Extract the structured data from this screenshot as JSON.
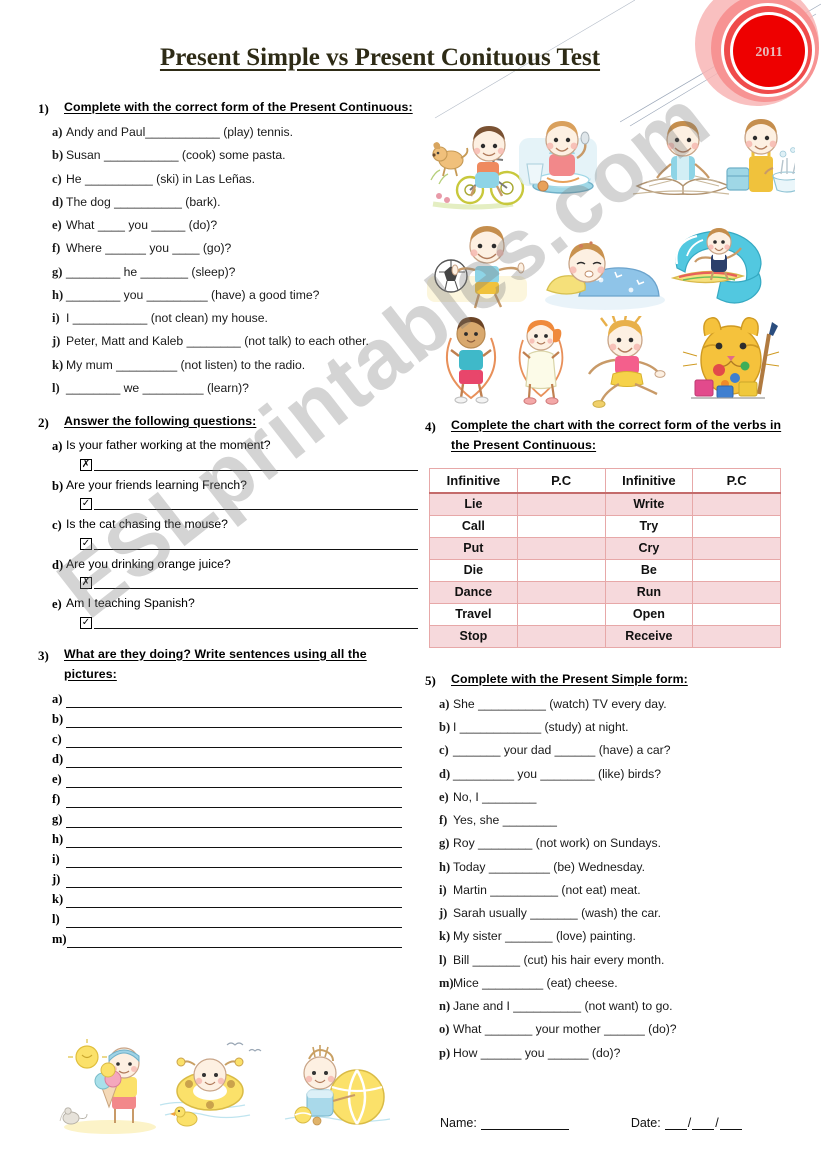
{
  "page": {
    "title": "Present Simple vs Present Conituous Test",
    "watermark": "ESLprintables.com",
    "badge_year": "2011",
    "accent_pink": "#f6d9dc",
    "accent_pink_border": "#e7a8a8",
    "badge_red": "#ee0000",
    "title_color": "#2e2b16"
  },
  "exercise1": {
    "number": "1)",
    "title": "Complete with the correct form of the Present Continuous:",
    "items": [
      {
        "letter": "a)",
        "text": "Andy and Paul___________ (play) tennis."
      },
      {
        "letter": "b)",
        "text": "Susan ___________ (cook) some pasta."
      },
      {
        "letter": "c)",
        "text": "He __________ (ski) in Las Leñas."
      },
      {
        "letter": "d)",
        "text": "The dog __________ (bark)."
      },
      {
        "letter": "e)",
        "text": "What ____ you _____ (do)?"
      },
      {
        "letter": "f)",
        "text": "Where ______ you ____ (go)?"
      },
      {
        "letter": "g)",
        "text": "________ he _______ (sleep)?"
      },
      {
        "letter": "h)",
        "text": "________ you _________ (have) a good time?"
      },
      {
        "letter": "i)",
        "text": "I ___________ (not clean) my house."
      },
      {
        "letter": "j)",
        "text": "Peter, Matt and Kaleb ________ (not talk) to each other."
      },
      {
        "letter": "k)",
        "text": "My mum _________ (not listen) to the radio."
      },
      {
        "letter": "l)",
        "text": "________ we _________ (learn)?"
      }
    ]
  },
  "exercise2": {
    "number": "2)",
    "title": "Answer the following questions:",
    "items": [
      {
        "letter": "a)",
        "question": "Is your father working at the moment?",
        "mark": "✗"
      },
      {
        "letter": "b)",
        "question": "Are your friends learning French?",
        "mark": "✓"
      },
      {
        "letter": "c)",
        "question": "Is the cat chasing the mouse?",
        "mark": "✓"
      },
      {
        "letter": "d)",
        "question": "Are you drinking orange juice?",
        "mark": "✗"
      },
      {
        "letter": "e)",
        "question": "Am I teaching Spanish?",
        "mark": "✓"
      }
    ]
  },
  "exercise3": {
    "number": "3)",
    "title": "What are they doing?  Write sentences using all the pictures:",
    "letters": [
      "a)",
      "b)",
      "c)",
      "d)",
      "e)",
      "f)",
      "g)",
      "h)",
      "i)",
      "j)",
      "k)",
      "l)",
      "m)"
    ]
  },
  "exercise4": {
    "number": "4)",
    "title": "Complete the chart with the correct form of the verbs in the Present Continuous:",
    "headers": [
      "Infinitive",
      "P.C",
      "Infinitive",
      "P.C"
    ],
    "rows": [
      {
        "left": "Lie",
        "left_answer": "",
        "right": "Write",
        "right_answer": "",
        "shade": "pink"
      },
      {
        "left": "Call",
        "left_answer": "",
        "right": "Try",
        "right_answer": "",
        "shade": "white"
      },
      {
        "left": "Put",
        "left_answer": "",
        "right": "Cry",
        "right_answer": "",
        "shade": "pink"
      },
      {
        "left": "Die",
        "left_answer": "",
        "right": "Be",
        "right_answer": "",
        "shade": "white"
      },
      {
        "left": "Dance",
        "left_answer": "",
        "right": "Run",
        "right_answer": "",
        "shade": "pink"
      },
      {
        "left": "Travel",
        "left_answer": "",
        "right": "Open",
        "right_answer": "",
        "shade": "white"
      },
      {
        "left": "Stop",
        "left_answer": "",
        "right": "Receive",
        "right_answer": "",
        "shade": "pink"
      }
    ]
  },
  "exercise5": {
    "number": "5)",
    "title": "Complete with the Present Simple form:",
    "items": [
      {
        "letter": "a)",
        "text": "She __________ (watch) TV every day."
      },
      {
        "letter": "b)",
        "text": "I ____________ (study) at night."
      },
      {
        "letter": "c)",
        "text": "_______ your dad ______ (have) a car?"
      },
      {
        "letter": "d)",
        "text": "_________ you ________ (like) birds?"
      },
      {
        "letter": "e)",
        "text": "No, I ________"
      },
      {
        "letter": "f)",
        "text": "Yes, she ________"
      },
      {
        "letter": "g)",
        "text": "Roy ________ (not work) on Sundays."
      },
      {
        "letter": "h)",
        "text": "Today _________ (be) Wednesday."
      },
      {
        "letter": "i)",
        "text": "Martin __________ (not eat) meat."
      },
      {
        "letter": "j)",
        "text": " Sarah usually _______ (wash) the car."
      },
      {
        "letter": "k)",
        "text": "My sister _______ (love) painting."
      },
      {
        "letter": "l)",
        "text": "Bill _______ (cut) his hair every month."
      },
      {
        "letter": "m)",
        "text": "Mice _________ (eat) cheese."
      },
      {
        "letter": "n)",
        "text": "Jane and I __________ (not want) to go."
      },
      {
        "letter": "o)",
        "text": "What _______ your mother ______ (do)?"
      },
      {
        "letter": "p)",
        "text": "How ______ you ______ (do)?"
      }
    ]
  },
  "footer": {
    "name_label": "Name:",
    "date_label": "Date:",
    "slash": "/"
  },
  "illustrations": {
    "row1": [
      "boy-riding-bicycle",
      "boy-eating-breakfast",
      "boy-reading-book",
      "boy-washing-dishes"
    ],
    "row2": [
      "boy-playing-football",
      "boy-sleeping",
      "boy-surfing"
    ],
    "row3": [
      "boy-skipping-rope",
      "girl-skipping-rope",
      "girl-jumping",
      "cat-painting"
    ],
    "bottom": [
      "kid-eating-ice-cream",
      "kid-swimming-ring",
      "girl-with-beach-ball"
    ]
  }
}
